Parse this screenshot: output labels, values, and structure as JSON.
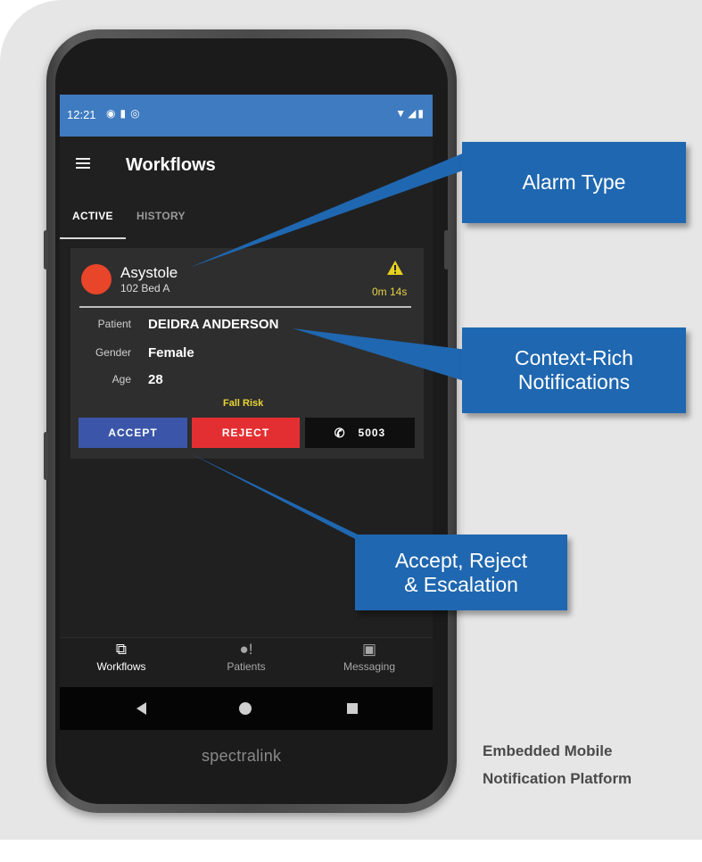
{
  "status_bar": {
    "time": "12:21",
    "left_icons": [
      "notification-icon",
      "sim-icon",
      "sync-icon"
    ],
    "right_icons": [
      "wifi-icon",
      "signal-icon",
      "battery-icon"
    ],
    "color": "#3f7bc0"
  },
  "app_bar": {
    "title": "Workflows"
  },
  "tabs": [
    {
      "label": "ACTIVE",
      "selected": true
    },
    {
      "label": "HISTORY",
      "selected": false
    }
  ],
  "alarm": {
    "type": "Asystole",
    "location": "102 Bed A",
    "elapsed": "0m 14s",
    "indicator_color": "#e8452a"
  },
  "patient": {
    "name_label": "Patient",
    "name": "DEIDRA ANDERSON",
    "gender_label": "Gender",
    "gender": "Female",
    "age_label": "Age",
    "age": "28",
    "flag": "Fall Risk"
  },
  "actions": {
    "accept": "ACCEPT",
    "reject": "REJECT",
    "call": "5003"
  },
  "bottom_nav": [
    {
      "label": "Workflows",
      "icon": "cast-icon",
      "selected": true
    },
    {
      "label": "Patients",
      "icon": "patient-alert-icon",
      "selected": false
    },
    {
      "label": "Messaging",
      "icon": "contact-card-icon",
      "selected": false
    }
  ],
  "device_brand": "spectralink",
  "callouts": {
    "alarm_type": "Alarm Type",
    "notifications": [
      "Context-Rich",
      "Notifications"
    ],
    "escalation": [
      "Accept, Reject",
      "& Escalation"
    ],
    "color": "#1f67b0"
  },
  "platform_label": [
    "Embedded Mobile",
    "Notification Platform"
  ]
}
